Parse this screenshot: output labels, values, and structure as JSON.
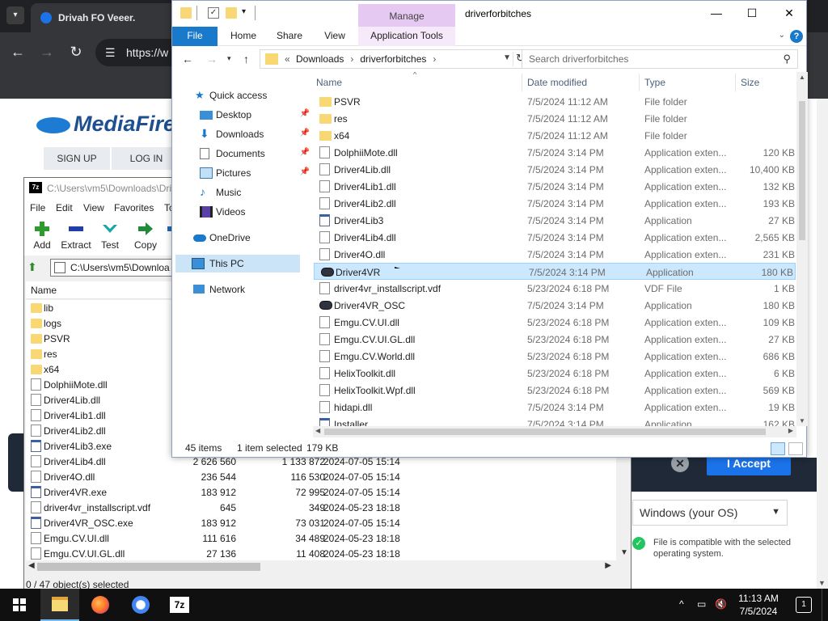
{
  "browser": {
    "tab_title": "Drivah FO Veeer.",
    "url": "https://w",
    "mediafire": {
      "logo": "MediaFire",
      "sign_up": "SIGN UP",
      "log_in": "LOG IN",
      "accept_label": "I Accept",
      "os_select_value": "Windows (your OS)",
      "compat_text": "File is compatible with the selected operating system."
    }
  },
  "sevenzip": {
    "title": "C:\\Users\\vm5\\Downloads\\Dri",
    "menu": [
      "File",
      "Edit",
      "View",
      "Favorites",
      "To"
    ],
    "tools": [
      "Add",
      "Extract",
      "Test",
      "Copy",
      "M"
    ],
    "path": "C:\\Users\\vm5\\Downloa",
    "columns": {
      "name": "Name"
    },
    "rows": [
      {
        "icon": "folder",
        "name": "lib",
        "size": "",
        "packed": "",
        "date": ""
      },
      {
        "icon": "folder",
        "name": "logs",
        "size": "",
        "packed": "",
        "date": ""
      },
      {
        "icon": "folder",
        "name": "PSVR",
        "size": "",
        "packed": "",
        "date": ""
      },
      {
        "icon": "folder",
        "name": "res",
        "size": "",
        "packed": "",
        "date": ""
      },
      {
        "icon": "folder",
        "name": "x64",
        "size": "",
        "packed": "",
        "date": ""
      },
      {
        "icon": "dll",
        "name": "DolphiiMote.dll",
        "size": "",
        "packed": "",
        "date": ""
      },
      {
        "icon": "dll",
        "name": "Driver4Lib.dll",
        "size": "",
        "packed": "",
        "date": ""
      },
      {
        "icon": "dll",
        "name": "Driver4Lib1.dll",
        "size": "",
        "packed": "",
        "date": ""
      },
      {
        "icon": "dll",
        "name": "Driver4Lib2.dll",
        "size": "",
        "packed": "",
        "date": ""
      },
      {
        "icon": "exe",
        "name": "Driver4Lib3.exe",
        "size": "",
        "packed": "",
        "date": ""
      },
      {
        "icon": "dll",
        "name": "Driver4Lib4.dll",
        "size": "2 626 560",
        "packed": "1 133 872",
        "date": "2024-07-05 15:14"
      },
      {
        "icon": "dll",
        "name": "Driver4O.dll",
        "size": "236 544",
        "packed": "116 530",
        "date": "2024-07-05 15:14"
      },
      {
        "icon": "exe",
        "name": "Driver4VR.exe",
        "size": "183 912",
        "packed": "72 995",
        "date": "2024-07-05 15:14"
      },
      {
        "icon": "vdf",
        "name": "driver4vr_installscript.vdf",
        "size": "645",
        "packed": "349",
        "date": "2024-05-23 18:18"
      },
      {
        "icon": "exe",
        "name": "Driver4VR_OSC.exe",
        "size": "183 912",
        "packed": "73 031",
        "date": "2024-07-05 15:14"
      },
      {
        "icon": "dll",
        "name": "Emgu.CV.UI.dll",
        "size": "111 616",
        "packed": "34 489",
        "date": "2024-05-23 18:18"
      },
      {
        "icon": "dll",
        "name": "Emgu.CV.UI.GL.dll",
        "size": "27 136",
        "packed": "11 408",
        "date": "2024-05-23 18:18"
      }
    ],
    "status": "0 / 47 object(s) selected"
  },
  "explorer": {
    "title": "driverforbitches",
    "manage_label": "Manage",
    "ribbon_tabs": [
      "File",
      "Home",
      "Share",
      "View",
      "Application Tools"
    ],
    "address": {
      "root": "Downloads",
      "folder": "driverforbitches"
    },
    "search_placeholder": "Search driverforbitches",
    "nav": {
      "quick_access": "Quick access",
      "desktop": "Desktop",
      "downloads": "Downloads",
      "documents": "Documents",
      "pictures": "Pictures",
      "music": "Music",
      "videos": "Videos",
      "onedrive": "OneDrive",
      "this_pc": "This PC",
      "network": "Network"
    },
    "columns": {
      "name": "Name",
      "date": "Date modified",
      "type": "Type",
      "size": "Size"
    },
    "files": [
      {
        "icon": "folder",
        "name": "PSVR",
        "date": "7/5/2024 11:12 AM",
        "type": "File folder",
        "size": ""
      },
      {
        "icon": "folder",
        "name": "res",
        "date": "7/5/2024 11:12 AM",
        "type": "File folder",
        "size": ""
      },
      {
        "icon": "folder",
        "name": "x64",
        "date": "7/5/2024 11:12 AM",
        "type": "File folder",
        "size": ""
      },
      {
        "icon": "dll",
        "name": "DolphiiMote.dll",
        "date": "7/5/2024 3:14 PM",
        "type": "Application exten...",
        "size": "120 KB"
      },
      {
        "icon": "dll",
        "name": "Driver4Lib.dll",
        "date": "7/5/2024 3:14 PM",
        "type": "Application exten...",
        "size": "10,400 KB"
      },
      {
        "icon": "dll",
        "name": "Driver4Lib1.dll",
        "date": "7/5/2024 3:14 PM",
        "type": "Application exten...",
        "size": "132 KB"
      },
      {
        "icon": "dll",
        "name": "Driver4Lib2.dll",
        "date": "7/5/2024 3:14 PM",
        "type": "Application exten...",
        "size": "193 KB"
      },
      {
        "icon": "exe",
        "name": "Driver4Lib3",
        "date": "7/5/2024 3:14 PM",
        "type": "Application",
        "size": "27 KB"
      },
      {
        "icon": "dll",
        "name": "Driver4Lib4.dll",
        "date": "7/5/2024 3:14 PM",
        "type": "Application exten...",
        "size": "2,565 KB"
      },
      {
        "icon": "dll",
        "name": "Driver4O.dll",
        "date": "7/5/2024 3:14 PM",
        "type": "Application exten...",
        "size": "231 KB"
      },
      {
        "icon": "vr",
        "name": "Driver4VR",
        "date": "7/5/2024 3:14 PM",
        "type": "Application",
        "size": "180 KB",
        "selected": true
      },
      {
        "icon": "vdf",
        "name": "driver4vr_installscript.vdf",
        "date": "5/23/2024 6:18 PM",
        "type": "VDF File",
        "size": "1 KB"
      },
      {
        "icon": "vr",
        "name": "Driver4VR_OSC",
        "date": "7/5/2024 3:14 PM",
        "type": "Application",
        "size": "180 KB"
      },
      {
        "icon": "dll",
        "name": "Emgu.CV.UI.dll",
        "date": "5/23/2024 6:18 PM",
        "type": "Application exten...",
        "size": "109 KB"
      },
      {
        "icon": "dll",
        "name": "Emgu.CV.UI.GL.dll",
        "date": "5/23/2024 6:18 PM",
        "type": "Application exten...",
        "size": "27 KB"
      },
      {
        "icon": "dll",
        "name": "Emgu.CV.World.dll",
        "date": "5/23/2024 6:18 PM",
        "type": "Application exten...",
        "size": "686 KB"
      },
      {
        "icon": "dll",
        "name": "HelixToolkit.dll",
        "date": "5/23/2024 6:18 PM",
        "type": "Application exten...",
        "size": "6 KB"
      },
      {
        "icon": "dll",
        "name": "HelixToolkit.Wpf.dll",
        "date": "5/23/2024 6:18 PM",
        "type": "Application exten...",
        "size": "569 KB"
      },
      {
        "icon": "dll",
        "name": "hidapi.dll",
        "date": "7/5/2024 3:14 PM",
        "type": "Application exten...",
        "size": "19 KB"
      },
      {
        "icon": "exe",
        "name": "Installer",
        "date": "7/5/2024 3:14 PM",
        "type": "Application",
        "size": "162 KB"
      }
    ],
    "status": {
      "items": "45 items",
      "selected": "1 item selected",
      "size": "179 KB"
    }
  },
  "taskbar": {
    "time": "11:13 AM",
    "date": "7/5/2024",
    "notification_count": "1",
    "apps": [
      "file-explorer",
      "firefox",
      "chrome",
      "7-zip"
    ]
  },
  "colors": {
    "ribbon_file": "#1979ca",
    "manage_tab": "#e6c9f2",
    "selection": "#cce8ff",
    "folder": "#f8d775",
    "taskbar": "#101010"
  }
}
